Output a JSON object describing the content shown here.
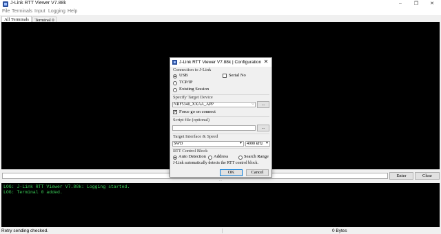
{
  "window": {
    "title": "J-Link RTT Viewer V7.88k",
    "minimize_glyph": "–",
    "restore_glyph": "❐",
    "close_glyph": "✕"
  },
  "menu": [
    "File",
    "Terminals",
    "Input",
    "Logging",
    "Help"
  ],
  "tabs": [
    "All Terminals",
    "Terminal 0"
  ],
  "input_bar": {
    "enter_label": "Enter",
    "clear_label": "Clear"
  },
  "log": [
    "LOG: J-Link RTT Viewer V7.88k: Logging started.",
    "LOG: Terminal 0 added."
  ],
  "status": {
    "left": "Retry sending checked.",
    "bytes": "0 Bytes"
  },
  "dialog": {
    "title": "J-Link RTT Viewer V7.88k | Configuration",
    "close_glyph": "✕",
    "connection": {
      "label": "Connection to J-Link",
      "options": [
        "USB",
        "TCP/IP",
        "Existing Session"
      ],
      "selected": "USB",
      "serial_no_label": "Serial No",
      "serial_no_checked": false
    },
    "target": {
      "label": "Specify Target Device",
      "device": "NRF5340_XXAA_APP",
      "browse_label": "...",
      "force_go_label": "Force go on connect",
      "force_go_checked": true
    },
    "script": {
      "label": "Script file (optional)",
      "value": "",
      "browse_label": "..."
    },
    "interface": {
      "label": "Target Interface & Speed",
      "interface": "SWD",
      "speed": "4000 kHz"
    },
    "rtt": {
      "label": "RTT Control Block",
      "options": [
        "Auto Detection",
        "Address",
        "Search Range"
      ],
      "selected": "Auto Detection",
      "note": "J-Link automatically detects the RTT control block."
    },
    "ok_label": "OK",
    "cancel_label": "Cancel"
  },
  "colors": {
    "terminal_bg": "#000000",
    "log_text": "#3cd25a",
    "accent": "#0078d7"
  }
}
